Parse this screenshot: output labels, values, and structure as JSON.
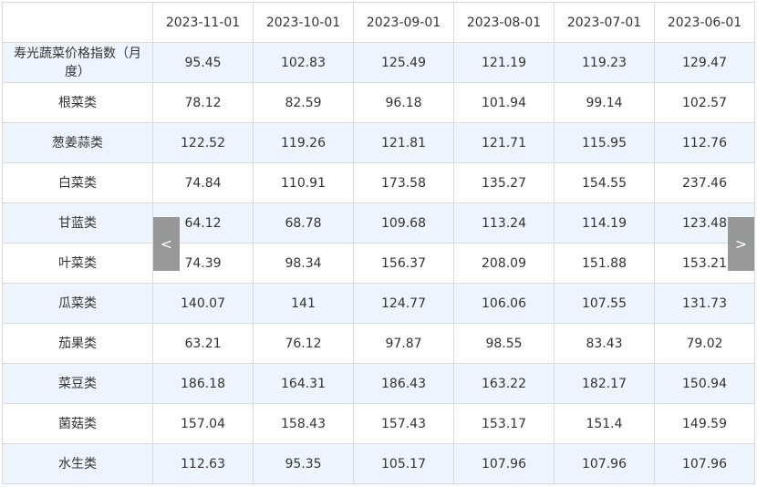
{
  "table": {
    "columns": [
      "",
      "2023-11-01",
      "2023-10-01",
      "2023-09-01",
      "2023-08-01",
      "2023-07-01",
      "2023-06-01"
    ],
    "rows": [
      {
        "label": "寿光蔬菜价格指数（月度）",
        "values": [
          "95.45",
          "102.83",
          "125.49",
          "121.19",
          "119.23",
          "129.47"
        ]
      },
      {
        "label": "根菜类",
        "values": [
          "78.12",
          "82.59",
          "96.18",
          "101.94",
          "99.14",
          "102.57"
        ]
      },
      {
        "label": "葱姜蒜类",
        "values": [
          "122.52",
          "119.26",
          "121.81",
          "121.71",
          "115.95",
          "112.76"
        ]
      },
      {
        "label": "白菜类",
        "values": [
          "74.84",
          "110.91",
          "173.58",
          "135.27",
          "154.55",
          "237.46"
        ]
      },
      {
        "label": "甘蓝类",
        "values": [
          "64.12",
          "68.78",
          "109.68",
          "113.24",
          "114.19",
          "123.48"
        ]
      },
      {
        "label": "叶菜类",
        "values": [
          "74.39",
          "98.34",
          "156.37",
          "208.09",
          "151.88",
          "153.21"
        ]
      },
      {
        "label": "瓜菜类",
        "values": [
          "140.07",
          "141",
          "124.77",
          "106.06",
          "107.55",
          "131.73"
        ]
      },
      {
        "label": "茄果类",
        "values": [
          "63.21",
          "76.12",
          "97.87",
          "98.55",
          "83.43",
          "79.02"
        ]
      },
      {
        "label": "菜豆类",
        "values": [
          "186.18",
          "164.31",
          "186.43",
          "163.22",
          "182.17",
          "150.94"
        ]
      },
      {
        "label": "菌菇类",
        "values": [
          "157.04",
          "158.43",
          "157.43",
          "153.17",
          "151.4",
          "149.59"
        ]
      },
      {
        "label": "水生类",
        "values": [
          "112.63",
          "95.35",
          "105.17",
          "107.96",
          "107.96",
          "107.96"
        ]
      }
    ]
  },
  "nav": {
    "prev_label": "<",
    "next_label": ">"
  },
  "colors": {
    "stripe": "#eef4fd",
    "border": "#d9d9d9",
    "arrow_bg": "#8d8d8d"
  }
}
